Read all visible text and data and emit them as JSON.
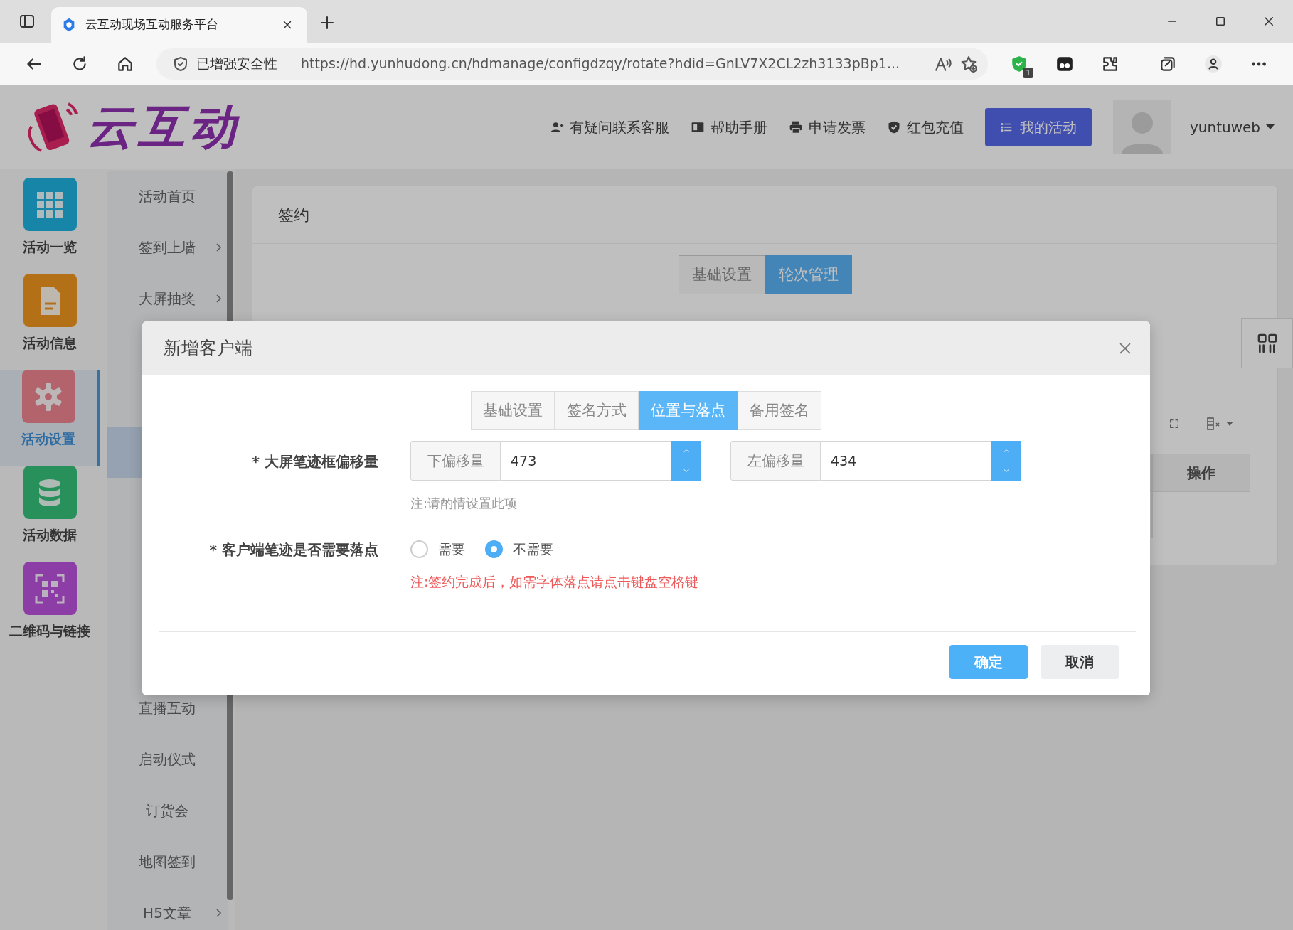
{
  "browser": {
    "tab_title": "云互动现场互动服务平台",
    "security_label": "已增强安全性",
    "url": "https://hd.yunhudong.cn/hdmanage/configdzqy/rotate?hdid=GnLV7X2CL2zh3133pBp1...",
    "extension_badge": "1"
  },
  "header": {
    "logo_text": "云互动",
    "links": [
      {
        "label": "有疑问联系客服"
      },
      {
        "label": "帮助手册"
      },
      {
        "label": "申请发票"
      },
      {
        "label": "红包充值"
      }
    ],
    "primary_button": "我的活动",
    "username": "yuntuweb"
  },
  "sidebar": {
    "items": [
      {
        "label": "活动一览",
        "selected": false
      },
      {
        "label": "活动信息",
        "selected": false
      },
      {
        "label": "活动设置",
        "selected": true
      },
      {
        "label": "活动数据",
        "selected": false
      },
      {
        "label": "二维码与链接",
        "selected": false
      }
    ]
  },
  "submenu": {
    "items": [
      {
        "kind": "link",
        "label": "活动首页",
        "expandable": false,
        "selected": false
      },
      {
        "kind": "link",
        "label": "签到上墙",
        "expandable": true,
        "selected": false
      },
      {
        "kind": "link",
        "label": "大屏抽奖",
        "expandable": true,
        "selected": false
      },
      {
        "kind": "covered",
        "selected": false
      },
      {
        "kind": "covered",
        "selected": false
      },
      {
        "kind": "covered",
        "selected": true
      },
      {
        "kind": "covered",
        "selected": false
      },
      {
        "kind": "covered",
        "selected": false
      },
      {
        "kind": "covered",
        "selected": false
      },
      {
        "kind": "covered",
        "selected": false
      },
      {
        "kind": "link",
        "label": "直播互动",
        "expandable": false,
        "selected": false
      },
      {
        "kind": "link",
        "label": "启动仪式",
        "expandable": false,
        "selected": false
      },
      {
        "kind": "link",
        "label": "订货会",
        "expandable": false,
        "selected": false
      },
      {
        "kind": "link",
        "label": "地图签到",
        "expandable": false,
        "selected": false
      },
      {
        "kind": "link",
        "label": "H5文章",
        "expandable": true,
        "selected": false
      }
    ]
  },
  "content": {
    "title": "签约",
    "tabs": [
      {
        "label": "基础设置",
        "selected": false
      },
      {
        "label": "轮次管理",
        "selected": true
      }
    ],
    "table": {
      "columns": [
        "操作"
      ]
    }
  },
  "dialog": {
    "title": "新增客户端",
    "tabs": [
      {
        "label": "基础设置",
        "selected": false
      },
      {
        "label": "签名方式",
        "selected": false
      },
      {
        "label": "位置与落点",
        "selected": true
      },
      {
        "label": "备用签名",
        "selected": false
      }
    ],
    "offset": {
      "label": "* 大屏笔迹框偏移量",
      "fields": [
        {
          "addon": "下偏移量",
          "value": "473"
        },
        {
          "addon": "左偏移量",
          "value": "434"
        }
      ],
      "hint": "注:请酌情设置此项"
    },
    "landing": {
      "label": "* 客户端笔迹是否需要落点",
      "options": [
        {
          "label": "需要",
          "selected": false
        },
        {
          "label": "不需要",
          "selected": true
        }
      ],
      "note": "注:签约完成后，如需字体落点请点击键盘空格键"
    },
    "buttons": [
      {
        "label": "确定",
        "kind": "primary"
      },
      {
        "label": "取消",
        "kind": "secondary"
      }
    ]
  }
}
